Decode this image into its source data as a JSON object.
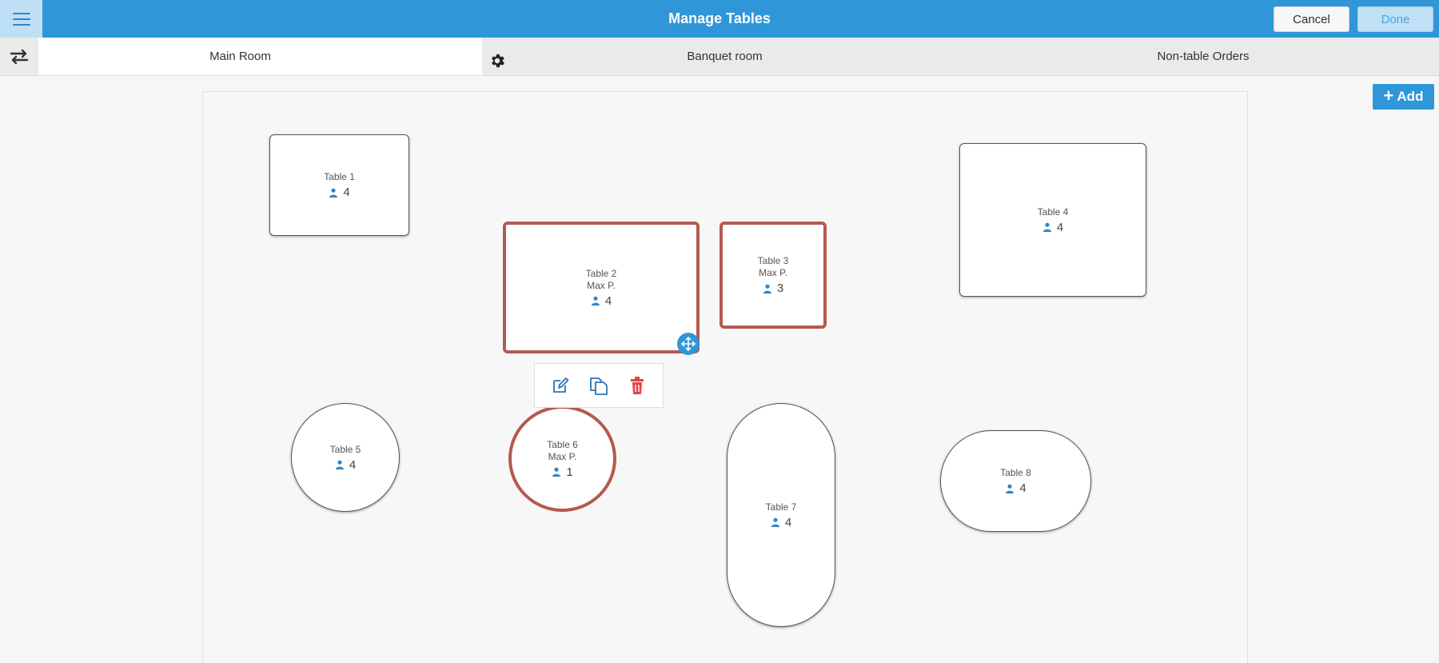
{
  "header": {
    "title": "Manage Tables",
    "cancel_label": "Cancel",
    "done_label": "Done",
    "menu_icon": "hamburger-menu-icon",
    "colors": {
      "bar": "#2f96d8",
      "selected_border": "#b45a50"
    }
  },
  "tabs": [
    {
      "label": "Main Room",
      "active": true
    },
    {
      "label": "Banquet room",
      "active": false
    },
    {
      "label": "Non-table Orders",
      "active": false
    }
  ],
  "add_button": {
    "label": "Add"
  },
  "tables": [
    {
      "name": "Table 1",
      "max": "",
      "seats": "4",
      "shape": "rect",
      "selected": false
    },
    {
      "name": "Table 2",
      "max": "Max P.",
      "seats": "4",
      "shape": "rect",
      "selected": true
    },
    {
      "name": "Table 3",
      "max": "Max P.",
      "seats": "3",
      "shape": "rect",
      "selected": true
    },
    {
      "name": "Table 4",
      "max": "",
      "seats": "4",
      "shape": "rect",
      "selected": false
    },
    {
      "name": "Table 5",
      "max": "",
      "seats": "4",
      "shape": "circle",
      "selected": false
    },
    {
      "name": "Table 6",
      "max": "Max P.",
      "seats": "1",
      "shape": "circle",
      "selected": true
    },
    {
      "name": "Table 7",
      "max": "",
      "seats": "4",
      "shape": "oval",
      "selected": false
    },
    {
      "name": "Table 8",
      "max": "",
      "seats": "4",
      "shape": "oval",
      "selected": false
    }
  ],
  "toolbar_icons": [
    "edit-icon",
    "copy-icon",
    "delete-icon"
  ]
}
